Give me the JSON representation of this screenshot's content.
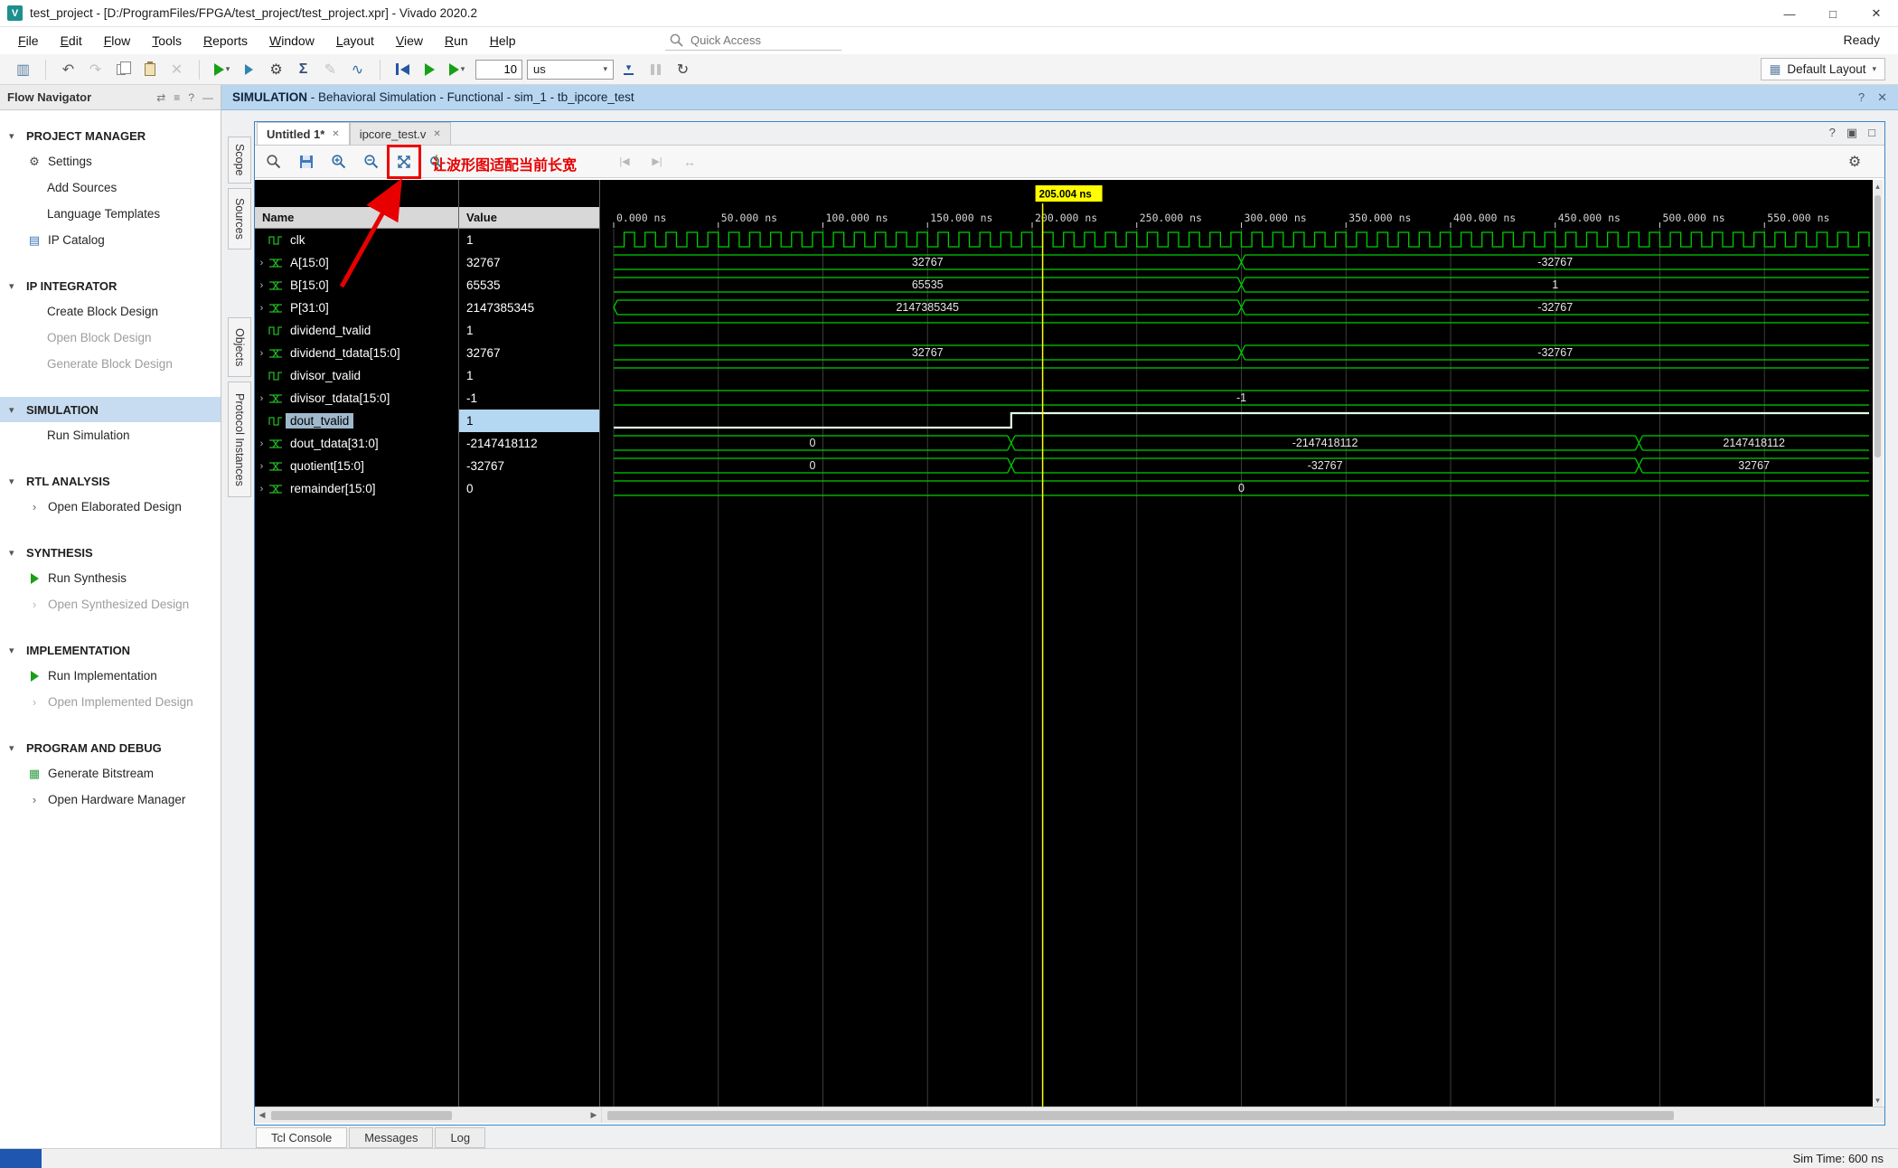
{
  "window": {
    "title": "test_project - [D:/ProgramFiles/FPGA/test_project/test_project.xpr] - Vivado 2020.2",
    "status_ready": "Ready",
    "controls": {
      "minimize": "—",
      "maximize": "□",
      "close": "✕"
    }
  },
  "menu": {
    "items": [
      "File",
      "Edit",
      "Flow",
      "Tools",
      "Reports",
      "Window",
      "Layout",
      "View",
      "Run",
      "Help"
    ]
  },
  "quick_access": {
    "placeholder": "Quick Access"
  },
  "toolbar": {
    "time_value": "10",
    "time_unit": "us",
    "layout_label": "Default Layout"
  },
  "context_bar": {
    "mode": "SIMULATION",
    "detail": " - Behavioral Simulation - Functional - sim_1 - tb_ipcore_test"
  },
  "flow_navigator": {
    "title": "Flow Navigator",
    "sections": [
      {
        "label": "PROJECT MANAGER",
        "items": [
          {
            "label": "Settings"
          },
          {
            "label": "Add Sources"
          },
          {
            "label": "Language Templates"
          },
          {
            "label": "IP Catalog"
          }
        ]
      },
      {
        "label": "IP INTEGRATOR",
        "items": [
          {
            "label": "Create Block Design"
          },
          {
            "label": "Open Block Design"
          },
          {
            "label": "Generate Block Design"
          }
        ]
      },
      {
        "label": "SIMULATION",
        "items": [
          {
            "label": "Run Simulation"
          }
        ]
      },
      {
        "label": "RTL ANALYSIS",
        "items": [
          {
            "label": "Open Elaborated Design"
          }
        ]
      },
      {
        "label": "SYNTHESIS",
        "items": [
          {
            "label": "Run Synthesis"
          },
          {
            "label": "Open Synthesized Design"
          }
        ]
      },
      {
        "label": "IMPLEMENTATION",
        "items": [
          {
            "label": "Run Implementation"
          },
          {
            "label": "Open Implemented Design"
          }
        ]
      },
      {
        "label": "PROGRAM AND DEBUG",
        "items": [
          {
            "label": "Generate Bitstream"
          },
          {
            "label": "Open Hardware Manager"
          }
        ]
      }
    ]
  },
  "side_tabs": [
    "Scope",
    "Sources",
    "Objects",
    "Protocol Instances"
  ],
  "editor": {
    "tabs": [
      {
        "label": "Untitled 1*"
      },
      {
        "label": "ipcore_test.v"
      }
    ],
    "columns": {
      "name": "Name",
      "value": "Value"
    },
    "annotation": {
      "text": "让波形图适配当前长宽"
    }
  },
  "bottom_tabs": [
    "Tcl Console",
    "Messages",
    "Log"
  ],
  "status_bar": {
    "sim_time": "Sim Time: 600 ns"
  },
  "icons": {
    "close": "✕",
    "help": "?",
    "dropdown": "▾",
    "expander": "›",
    "section_chevron": "▾",
    "item_chevron": "›",
    "scroll_up": "▴",
    "scroll_down": "▾",
    "scroll_left": "◀",
    "scroll_right": "▶",
    "gear": "⚙",
    "sigma": "Σ",
    "undo": "↶",
    "redo": "↷",
    "delete": "✕",
    "pencil": "✎",
    "probe": "∿",
    "relaunch": "↻",
    "goto_start": "|◀",
    "goto_end": "▶|",
    "swap": "↔",
    "prev_edge": "⇤",
    "next_edge": "⇥",
    "window_icon": "▥",
    "layout": "▦",
    "float": "▣",
    "maximize_small": "□",
    "ip": "▤",
    "bitstream": "▦"
  },
  "chart_data": {
    "type": "waveform",
    "time_unit": "ns",
    "t_start": 0,
    "t_end": 600,
    "ticks": [
      0,
      50,
      100,
      150,
      200,
      250,
      300,
      350,
      400,
      450,
      500,
      550
    ],
    "tick_labels": [
      "0.000 ns",
      "50.000 ns",
      "100.000 ns",
      "150.000 ns",
      "200.000 ns",
      "250.000 ns",
      "300.000 ns",
      "350.000 ns",
      "400.000 ns",
      "450.000 ns",
      "500.000 ns",
      "550.000 ns"
    ],
    "cursor": {
      "time": 205.004,
      "label": "205.004 ns"
    },
    "colors": {
      "trace": "#00cf00",
      "trace_selected": "#e4ffe4",
      "grid": "#3c3c3c",
      "cursor": "#ffff00",
      "bus_label": "#e6e6e6",
      "axis_label": "#d4d4d4"
    },
    "signals": [
      {
        "name": "clk",
        "value": "1",
        "kind": "clock",
        "period": 10,
        "expandable": false,
        "selected": false
      },
      {
        "name": "A[15:0]",
        "value": "32767",
        "kind": "bus",
        "expandable": true,
        "selected": false,
        "segments": [
          {
            "t0": 0,
            "t1": 300,
            "label": "32767"
          },
          {
            "t0": 300,
            "t1": 600,
            "label": "-32767"
          }
        ]
      },
      {
        "name": "B[15:0]",
        "value": "65535",
        "kind": "bus",
        "expandable": true,
        "selected": false,
        "segments": [
          {
            "t0": 0,
            "t1": 300,
            "label": "65535"
          },
          {
            "t0": 300,
            "t1": 600,
            "label": "1"
          }
        ]
      },
      {
        "name": "P[31:0]",
        "value": "2147385345",
        "kind": "bus",
        "expandable": true,
        "selected": false,
        "initial_transition": true,
        "segments": [
          {
            "t0": 0,
            "t1": 300,
            "label": "2147385345"
          },
          {
            "t0": 300,
            "t1": 600,
            "label": "-32767"
          }
        ]
      },
      {
        "name": "dividend_tvalid",
        "value": "1",
        "kind": "bit",
        "expandable": false,
        "selected": false,
        "segments": [
          {
            "t0": 0,
            "t1": 600,
            "v": 1
          }
        ]
      },
      {
        "name": "dividend_tdata[15:0]",
        "value": "32767",
        "kind": "bus",
        "expandable": true,
        "selected": false,
        "segments": [
          {
            "t0": 0,
            "t1": 300,
            "label": "32767"
          },
          {
            "t0": 300,
            "t1": 600,
            "label": "-32767"
          }
        ]
      },
      {
        "name": "divisor_tvalid",
        "value": "1",
        "kind": "bit",
        "expandable": false,
        "selected": false,
        "segments": [
          {
            "t0": 0,
            "t1": 600,
            "v": 1
          }
        ]
      },
      {
        "name": "divisor_tdata[15:0]",
        "value": "-1",
        "kind": "bus",
        "expandable": true,
        "selected": false,
        "segments": [
          {
            "t0": 0,
            "t1": 600,
            "label": "-1"
          }
        ]
      },
      {
        "name": "dout_tvalid",
        "value": "1",
        "kind": "bit",
        "expandable": false,
        "selected": true,
        "segments": [
          {
            "t0": 0,
            "t1": 190,
            "v": 0
          },
          {
            "t0": 190,
            "t1": 600,
            "v": 1
          }
        ]
      },
      {
        "name": "dout_tdata[31:0]",
        "value": "-2147418112",
        "kind": "bus",
        "expandable": true,
        "selected": false,
        "segments": [
          {
            "t0": 0,
            "t1": 190,
            "label": "0"
          },
          {
            "t0": 190,
            "t1": 490,
            "label": "-2147418112"
          },
          {
            "t0": 490,
            "t1": 600,
            "label": "2147418112"
          }
        ]
      },
      {
        "name": "quotient[15:0]",
        "value": "-32767",
        "kind": "bus",
        "expandable": true,
        "selected": false,
        "segments": [
          {
            "t0": 0,
            "t1": 190,
            "label": "0"
          },
          {
            "t0": 190,
            "t1": 490,
            "label": "-32767"
          },
          {
            "t0": 490,
            "t1": 600,
            "label": "32767"
          }
        ]
      },
      {
        "name": "remainder[15:0]",
        "value": "0",
        "kind": "bus",
        "expandable": true,
        "selected": false,
        "segments": [
          {
            "t0": 0,
            "t1": 600,
            "label": "0"
          }
        ]
      }
    ]
  }
}
